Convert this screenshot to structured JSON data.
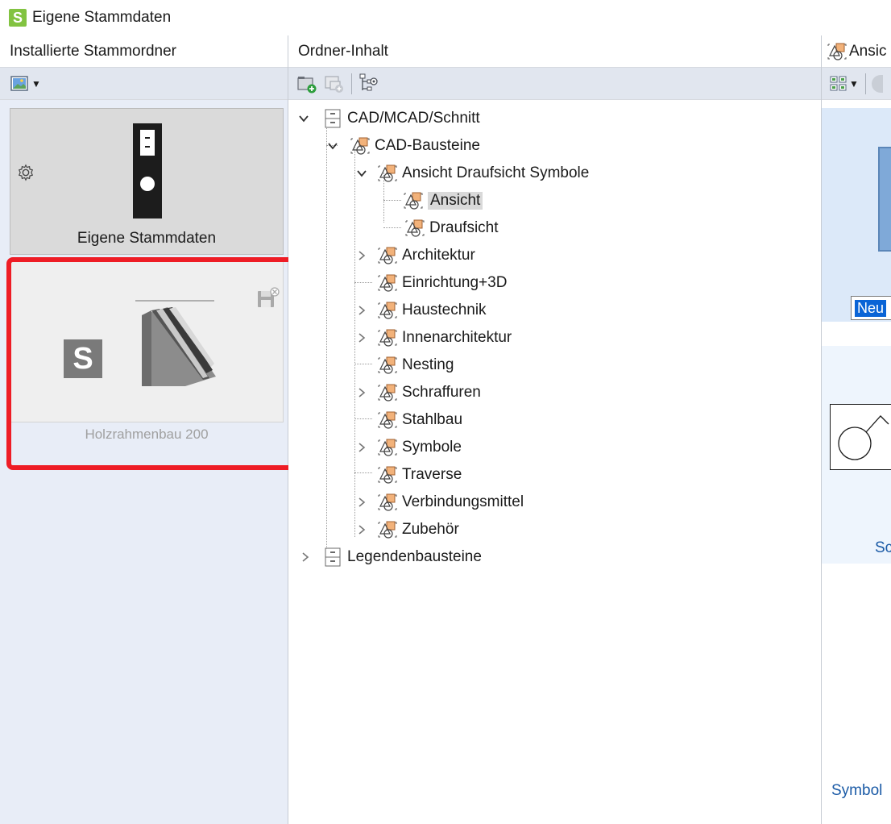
{
  "window": {
    "title": "Eigene Stammdaten",
    "logo_letter": "S"
  },
  "left_panel": {
    "header": "Installierte Stammordner",
    "cards": [
      {
        "label": "Eigene Stammdaten",
        "selected": true
      },
      {
        "label": "Holzrahmenbau 200",
        "logo_letter": "S",
        "highlighted": true
      }
    ]
  },
  "middle_panel": {
    "header": "Ordner-Inhalt",
    "tree": [
      {
        "label": "CAD/MCAD/Schnitt",
        "level": 0,
        "expander": "expanded",
        "icon": "cabinet-icon"
      },
      {
        "label": "CAD-Bausteine",
        "level": 1,
        "expander": "expanded",
        "icon": "symbol-folder-icon"
      },
      {
        "label": "Ansicht Draufsicht Symbole",
        "level": 2,
        "expander": "expanded",
        "icon": "symbol-folder-icon"
      },
      {
        "label": "Ansicht",
        "level": 3,
        "expander": "none",
        "icon": "symbol-folder-icon",
        "selected": true
      },
      {
        "label": "Draufsicht",
        "level": 3,
        "expander": "none",
        "icon": "symbol-folder-icon"
      },
      {
        "label": "Architektur",
        "level": 2,
        "expander": "collapsed",
        "icon": "symbol-folder-icon"
      },
      {
        "label": "Einrichtung+3D",
        "level": 2,
        "expander": "none",
        "icon": "symbol-folder-icon"
      },
      {
        "label": "Haustechnik",
        "level": 2,
        "expander": "collapsed",
        "icon": "symbol-folder-icon"
      },
      {
        "label": "Innenarchitektur",
        "level": 2,
        "expander": "collapsed",
        "icon": "symbol-folder-icon"
      },
      {
        "label": "Nesting",
        "level": 2,
        "expander": "none",
        "icon": "symbol-folder-icon"
      },
      {
        "label": "Schraffuren",
        "level": 2,
        "expander": "collapsed",
        "icon": "symbol-folder-icon"
      },
      {
        "label": "Stahlbau",
        "level": 2,
        "expander": "none",
        "icon": "symbol-folder-icon"
      },
      {
        "label": "Symbole",
        "level": 2,
        "expander": "collapsed",
        "icon": "symbol-folder-icon"
      },
      {
        "label": "Traverse",
        "level": 2,
        "expander": "none",
        "icon": "symbol-folder-icon"
      },
      {
        "label": "Verbindungsmittel",
        "level": 2,
        "expander": "collapsed",
        "icon": "symbol-folder-icon"
      },
      {
        "label": "Zubehör",
        "level": 2,
        "expander": "collapsed",
        "icon": "symbol-folder-icon"
      },
      {
        "label": "Legendenbausteine",
        "level": 0,
        "expander": "collapsed",
        "icon": "cabinet-icon"
      }
    ]
  },
  "right_panel": {
    "header": "Ansic",
    "input_value": "Neu",
    "partial_label": "Sc",
    "link": "Symbol"
  },
  "colors": {
    "accent_green": "#82c341",
    "highlight_red": "#ee1c25",
    "selection_blue": "#0a64d6",
    "link_blue": "#1a5aa6"
  }
}
